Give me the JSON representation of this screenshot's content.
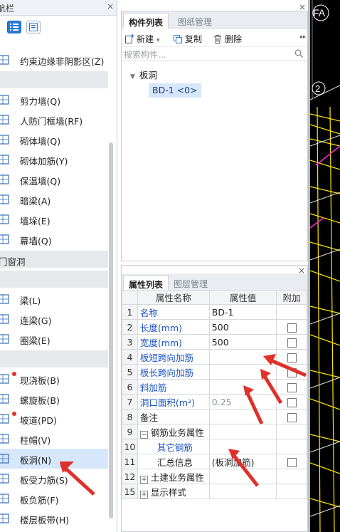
{
  "nav": {
    "title": "航栏",
    "items": [
      {
        "label": "约束边缘非阴影区(Z)",
        "icon": "constraint-edge-icon"
      },
      {
        "label": "剪力墙(Q)",
        "icon": "shear-wall-icon"
      },
      {
        "label": "人防门框墙(RF)",
        "icon": "civil-defense-door-wall-icon"
      },
      {
        "label": "砌体墙(Q)",
        "icon": "masonry-wall-icon"
      },
      {
        "label": "砌体加筋(Y)",
        "icon": "masonry-reinforcement-icon"
      },
      {
        "label": "保温墙(Q)",
        "icon": "insulation-wall-icon"
      },
      {
        "label": "暗梁(A)",
        "icon": "hidden-beam-icon"
      },
      {
        "label": "墙垛(E)",
        "icon": "wall-pier-icon"
      },
      {
        "label": "幕墙(Q)",
        "icon": "curtain-wall-icon"
      },
      {
        "label": "梁(L)",
        "icon": "beam-icon"
      },
      {
        "label": "连梁(G)",
        "icon": "coupling-beam-icon"
      },
      {
        "label": "圈梁(E)",
        "icon": "ring-beam-icon"
      },
      {
        "label": "现浇板(B)",
        "icon": "cast-slab-icon"
      },
      {
        "label": "螺旋板(B)",
        "icon": "spiral-slab-icon"
      },
      {
        "label": "坡道(PD)",
        "icon": "ramp-icon"
      },
      {
        "label": "柱帽(V)",
        "icon": "column-cap-icon"
      },
      {
        "label": "板洞(N)",
        "icon": "slab-hole-icon"
      },
      {
        "label": "板受力筋(S)",
        "icon": "slab-stress-rebar-icon"
      },
      {
        "label": "板负筋(F)",
        "icon": "slab-negative-rebar-icon"
      },
      {
        "label": "楼层板带(H)",
        "icon": "floor-strip-icon"
      }
    ],
    "groups": [
      "",
      "门窗洞",
      "",
      ""
    ]
  },
  "component_panel": {
    "tabs": [
      "构件列表",
      "图纸管理"
    ],
    "toolbar": {
      "new": "新建",
      "copy": "复制",
      "delete": "删除"
    },
    "search_placeholder": "搜索构件...",
    "tree": {
      "category": "板洞",
      "item": "BD-1 <0>"
    }
  },
  "property_panel": {
    "tabs": [
      "属性列表",
      "图层管理"
    ],
    "headers": [
      "属性名称",
      "属性值",
      "附加"
    ],
    "rows": [
      {
        "no": "1",
        "name": "名称",
        "value": "BD-1",
        "checkbox": false
      },
      {
        "no": "2",
        "name": "长度(mm)",
        "value": "500",
        "checkbox": true
      },
      {
        "no": "3",
        "name": "宽度(mm)",
        "value": "500",
        "checkbox": true
      },
      {
        "no": "4",
        "name": "板短跨向加筋",
        "value": "",
        "checkbox": true
      },
      {
        "no": "5",
        "name": "板长跨向加筋",
        "value": "",
        "checkbox": true
      },
      {
        "no": "6",
        "name": "斜加筋",
        "value": "",
        "checkbox": true
      },
      {
        "no": "7",
        "name": "洞口面积(m²)",
        "value": "0.25",
        "checkbox": true
      },
      {
        "no": "8",
        "name": "备注",
        "value": "",
        "checkbox": true
      },
      {
        "no": "9",
        "name": "钢筋业务属性",
        "value": "",
        "checkbox": false
      },
      {
        "no": "10",
        "name": "其它钢筋",
        "value": "",
        "checkbox": false
      },
      {
        "no": "11",
        "name": "汇总信息",
        "value": "(板洞加筋)",
        "checkbox": true
      },
      {
        "no": "12",
        "name": "土建业务属性",
        "value": "",
        "checkbox": false
      },
      {
        "no": "15",
        "name": "显示样式",
        "value": "",
        "checkbox": false
      }
    ],
    "expanders": {
      "minus": "−",
      "plus": "+"
    }
  },
  "viewport": {
    "label_fa": "FA",
    "label_2": "2"
  },
  "glyphs": {
    "close": "×",
    "more": "▸▸",
    "tree_arrow": "▼"
  },
  "colors": {
    "accent": "#2a7ad6",
    "selected_row": "#d7e7fb",
    "link_blue": "#1b52c5",
    "annotation_red": "#e0302a",
    "cad_yellow": "#ffe600",
    "cad_magenta": "#ff2bd6"
  }
}
